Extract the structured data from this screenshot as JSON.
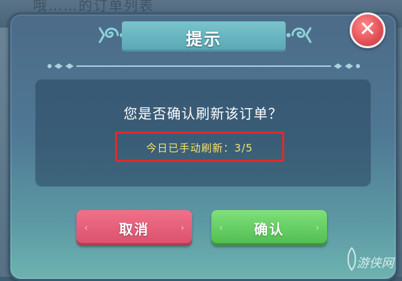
{
  "background": {
    "partial_text": "哦……的订单列表"
  },
  "dialog": {
    "title": "提示",
    "question": "您是否确认刷新该订单？",
    "refresh_status": "今日已手动刷新：3/5",
    "refreshes_used": 3,
    "refreshes_max": 5
  },
  "buttons": {
    "cancel_label": "取消",
    "confirm_label": "确认",
    "close_icon": "close-icon"
  },
  "watermark": {
    "text": "游侠网"
  },
  "colors": {
    "highlight_box": "#e22a2a",
    "refresh_text": "#f3e46a",
    "cancel": "#e05a74",
    "confirm": "#5ccb5a",
    "close": "#e14f57"
  }
}
